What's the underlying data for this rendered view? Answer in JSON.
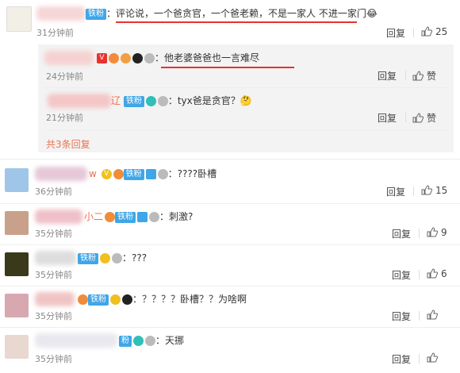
{
  "comments": [
    {
      "badge": "铁粉",
      "text": "：评论说，一个爸贪官，一个爸老赖，不是一家人 不进一家门",
      "emoji": "😂",
      "time": "31分钟前",
      "reply": "回复",
      "likes": "25"
    },
    {
      "text": "：????卧槽",
      "time": "36分钟前",
      "reply": "回复",
      "likes": "15",
      "badge": "铁粉",
      "suffix": "w"
    },
    {
      "text": "：刺激?",
      "time": "35分钟前",
      "reply": "回复",
      "likes": "9",
      "badge": "铁粉",
      "name": "小二"
    },
    {
      "text": "：???",
      "time": "35分钟前",
      "reply": "回复",
      "likes": "6",
      "badge": "铁粉"
    },
    {
      "text": "：？？？？卧槽？？为啥啊",
      "time": "35分钟前",
      "reply": "回复",
      "likes": "",
      "badge": "铁粉"
    },
    {
      "text": "：天挪",
      "time": "35分钟前",
      "reply": "回复",
      "likes": "",
      "badge": "粉"
    }
  ],
  "sub_replies": [
    {
      "text": "他老婆爸爸也一言难尽",
      "time": "24分钟前",
      "reply": "回复",
      "like_label": "赞"
    },
    {
      "badge": "铁粉",
      "text": "：tyx爸是贪官？",
      "emoji": "🤔",
      "time": "21分钟前",
      "reply": "回复",
      "like_label": "赞",
      "name_tail": "辽"
    }
  ],
  "more_replies": "共3条回复",
  "colors": {
    "accent": "#eb7350",
    "badge": "#3fa6e8",
    "underline": "#e8332f"
  }
}
